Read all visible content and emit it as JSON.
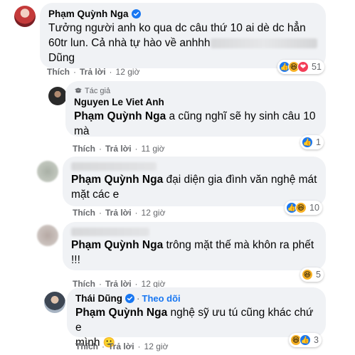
{
  "comments": [
    {
      "author": "Phạm Quỳnh Nga",
      "verified": true,
      "text_line1": "Tưởng người anh ko qua dc câu thứ 10 ai dè dc hẳn",
      "text_line2": "60tr lun. Cả nhà tự hào về anhhh",
      "text_line3": "Dũng",
      "actions": {
        "like": "Thích",
        "reply": "Trả lời",
        "time": "12 giờ"
      },
      "reaction_count": "51",
      "reaction_icons": [
        "like-icon",
        "haha-icon",
        "love-icon"
      ]
    },
    {
      "author_tag": "Tác giả",
      "author": "Nguyen Le Viet Anh",
      "mention": "Phạm Quỳnh Nga",
      "text_line1": " a cũng nghĩ sẽ hy sinh câu 10",
      "text_line2": "mà",
      "actions": {
        "like": "Thích",
        "reply": "Trả lời",
        "time": "11 giờ"
      },
      "reaction_count": "1",
      "reaction_icons": [
        "like-icon"
      ]
    },
    {
      "author": "",
      "mention": "Phạm Quỳnh Nga",
      "text_line1": " đại diện gia đình văn nghệ mát",
      "text_line2": "mặt các e",
      "actions": {
        "like": "Thích",
        "reply": "Trả lời",
        "time": "12 giờ"
      },
      "reaction_count": "10",
      "reaction_icons": [
        "like-icon",
        "haha-icon"
      ]
    },
    {
      "author": "",
      "mention": "Phạm Quỳnh Nga",
      "text_line1": " trông mặt thế mà khôn ra phết",
      "text_line2": "!!!",
      "actions": {
        "like": "Thích",
        "reply": "Trả lời",
        "time": "12 giờ"
      },
      "reaction_count": "5",
      "reaction_icons": [
        "haha-icon"
      ]
    },
    {
      "author": "Thái Dũng",
      "verified": true,
      "follow": "Theo dõi",
      "mention": "Phạm Quỳnh Nga",
      "text_line1": " nghệ sỹ ưu tú cũng khác chứ e",
      "text_line2": "mình",
      "emoji": "🙂",
      "actions": {
        "like": "Thích",
        "reply": "Trả lời",
        "time": "12 giờ"
      },
      "reaction_count": "3",
      "reaction_icons": [
        "haha-icon",
        "like-icon"
      ]
    }
  ],
  "colors": {
    "bubble": "#f0f2f5",
    "link_blue": "#1877f2",
    "meta_gray": "#65676b"
  }
}
